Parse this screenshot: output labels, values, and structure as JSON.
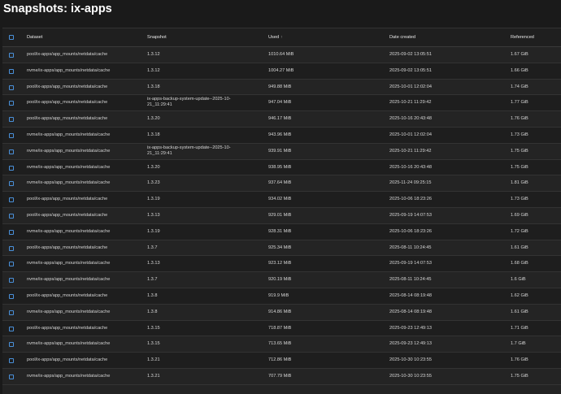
{
  "page": {
    "title": "Snapshots: ix-apps"
  },
  "table": {
    "columns": {
      "dataset": "Dataset",
      "snapshot": "Snapshot",
      "used": "Used",
      "date_created": "Date created",
      "referenced": "Referenced"
    },
    "rows": [
      {
        "dataset": "pool/ix-apps/app_mounts/netdata/cache",
        "snapshot": "1.3.12",
        "used": "1010.64 MiB",
        "date_created": "2025-09-02 13:05:51",
        "referenced": "1.67 GiB"
      },
      {
        "dataset": "nvme/ix-apps/app_mounts/netdata/cache",
        "snapshot": "1.3.12",
        "used": "1004.27 MiB",
        "date_created": "2025-09-02 13:05:51",
        "referenced": "1.66 GiB"
      },
      {
        "dataset": "pool/ix-apps/app_mounts/netdata/cache",
        "snapshot": "1.3.18",
        "used": "949.88 MiB",
        "date_created": "2025-10-01 12:02:04",
        "referenced": "1.74 GiB"
      },
      {
        "dataset": "pool/ix-apps/app_mounts/netdata/cache",
        "snapshot": "ix-apps-backup-system-update--2025-10-21_11:29:41",
        "used": "947.04 MiB",
        "date_created": "2025-10-21 11:29:42",
        "referenced": "1.77 GiB"
      },
      {
        "dataset": "pool/ix-apps/app_mounts/netdata/cache",
        "snapshot": "1.3.20",
        "used": "946.17 MiB",
        "date_created": "2025-10-16 20:43:48",
        "referenced": "1.76 GiB"
      },
      {
        "dataset": "nvme/ix-apps/app_mounts/netdata/cache",
        "snapshot": "1.3.18",
        "used": "943.96 MiB",
        "date_created": "2025-10-01 12:02:04",
        "referenced": "1.73 GiB"
      },
      {
        "dataset": "nvme/ix-apps/app_mounts/netdata/cache",
        "snapshot": "ix-apps-backup-system-update--2025-10-21_11:29:41",
        "used": "939.91 MiB",
        "date_created": "2025-10-21 11:29:42",
        "referenced": "1.75 GiB"
      },
      {
        "dataset": "nvme/ix-apps/app_mounts/netdata/cache",
        "snapshot": "1.3.20",
        "used": "938.95 MiB",
        "date_created": "2025-10-16 20:43:48",
        "referenced": "1.75 GiB"
      },
      {
        "dataset": "nvme/ix-apps/app_mounts/netdata/cache",
        "snapshot": "1.3.23",
        "used": "937.64 MiB",
        "date_created": "2025-11-24 09:25:15",
        "referenced": "1.81 GiB"
      },
      {
        "dataset": "pool/ix-apps/app_mounts/netdata/cache",
        "snapshot": "1.3.19",
        "used": "934.02 MiB",
        "date_created": "2025-10-06 18:23:26",
        "referenced": "1.73 GiB"
      },
      {
        "dataset": "pool/ix-apps/app_mounts/netdata/cache",
        "snapshot": "1.3.13",
        "used": "929.01 MiB",
        "date_created": "2025-09-19 14:07:53",
        "referenced": "1.69 GiB"
      },
      {
        "dataset": "nvme/ix-apps/app_mounts/netdata/cache",
        "snapshot": "1.3.19",
        "used": "928.31 MiB",
        "date_created": "2025-10-06 18:23:26",
        "referenced": "1.72 GiB"
      },
      {
        "dataset": "pool/ix-apps/app_mounts/netdata/cache",
        "snapshot": "1.3.7",
        "used": "925.34 MiB",
        "date_created": "2025-08-11 10:24:45",
        "referenced": "1.61 GiB"
      },
      {
        "dataset": "nvme/ix-apps/app_mounts/netdata/cache",
        "snapshot": "1.3.13",
        "used": "923.12 MiB",
        "date_created": "2025-09-19 14:07:53",
        "referenced": "1.68 GiB"
      },
      {
        "dataset": "nvme/ix-apps/app_mounts/netdata/cache",
        "snapshot": "1.3.7",
        "used": "920.19 MiB",
        "date_created": "2025-08-11 10:24:45",
        "referenced": "1.6 GiB"
      },
      {
        "dataset": "pool/ix-apps/app_mounts/netdata/cache",
        "snapshot": "1.3.8",
        "used": "919.9 MiB",
        "date_created": "2025-08-14 08:19:48",
        "referenced": "1.62 GiB"
      },
      {
        "dataset": "nvme/ix-apps/app_mounts/netdata/cache",
        "snapshot": "1.3.8",
        "used": "914.86 MiB",
        "date_created": "2025-08-14 08:19:48",
        "referenced": "1.61 GiB"
      },
      {
        "dataset": "pool/ix-apps/app_mounts/netdata/cache",
        "snapshot": "1.3.15",
        "used": "718.87 MiB",
        "date_created": "2025-09-23 12:49:13",
        "referenced": "1.71 GiB"
      },
      {
        "dataset": "nvme/ix-apps/app_mounts/netdata/cache",
        "snapshot": "1.3.15",
        "used": "713.65 MiB",
        "date_created": "2025-09-23 12:49:13",
        "referenced": "1.7 GiB"
      },
      {
        "dataset": "pool/ix-apps/app_mounts/netdata/cache",
        "snapshot": "1.3.21",
        "used": "712.86 MiB",
        "date_created": "2025-10-30 10:23:55",
        "referenced": "1.76 GiB"
      },
      {
        "dataset": "nvme/ix-apps/app_mounts/netdata/cache",
        "snapshot": "1.3.21",
        "used": "707.79 MiB",
        "date_created": "2025-10-30 10:23:55",
        "referenced": "1.75 GiB"
      }
    ]
  },
  "icons": {
    "sort": "sort-ascending-icon",
    "checkbox": "checkbox-icon"
  },
  "colors": {
    "background": "#1a1a1a",
    "table_bg": "#242424",
    "checkbox_border": "#4a90d9",
    "text": "#d6d6d6"
  }
}
